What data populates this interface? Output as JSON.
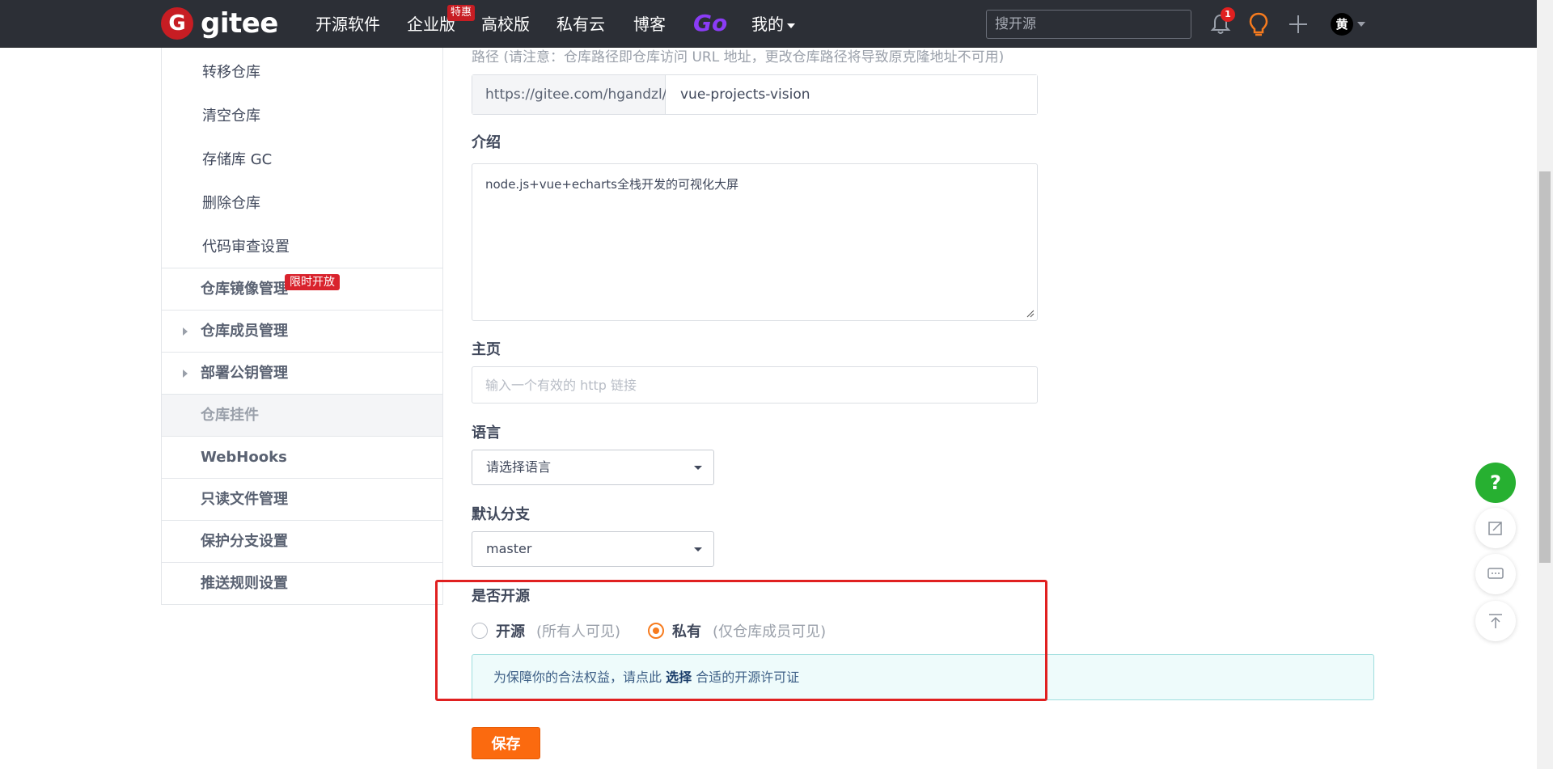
{
  "nav": {
    "logo_letter": "G",
    "logo_text": "gitee",
    "items": [
      "开源软件",
      "企业版",
      "高校版",
      "私有云",
      "博客"
    ],
    "enterprise_badge": "特惠",
    "go_label": "Go",
    "mine_label": "我的",
    "search_placeholder": "搜开源",
    "notification_count": "1",
    "avatar_text": "黄"
  },
  "sidebar": {
    "sub_items": [
      "转移仓库",
      "清空仓库",
      "存储库 GC",
      "删除仓库",
      "代码审查设置"
    ],
    "menu_items": [
      "仓库镜像管理",
      "仓库成员管理",
      "部署公钥管理",
      "仓库挂件",
      "WebHooks",
      "只读文件管理",
      "保护分支设置",
      "推送规则设置"
    ],
    "limited_badge": "限时开放"
  },
  "form": {
    "path_note": "路径 (请注意：仓库路径即仓库访问 URL 地址，更改仓库路径将导致原克隆地址不可用)",
    "url_prefix": "https://gitee.com/hgandzl/",
    "url_value": "vue-projects-vision",
    "intro_label": "介绍",
    "intro_value": "node.js+vue+echarts全栈开发的可视化大屏",
    "homepage_label": "主页",
    "homepage_placeholder": "输入一个有效的 http 链接",
    "language_label": "语言",
    "language_value": "请选择语言",
    "branch_label": "默认分支",
    "branch_value": "master",
    "visibility_label": "是否开源",
    "open_label": "开源",
    "open_hint": "(所有人可见)",
    "private_label": "私有",
    "private_hint": "(仅仓库成员可见)",
    "notice_before": "为保障你的合法权益，请点此 ",
    "notice_link": "选择",
    "notice_after": " 合适的开源许可证",
    "save_label": "保存"
  },
  "floating": {
    "help_label": "?"
  }
}
